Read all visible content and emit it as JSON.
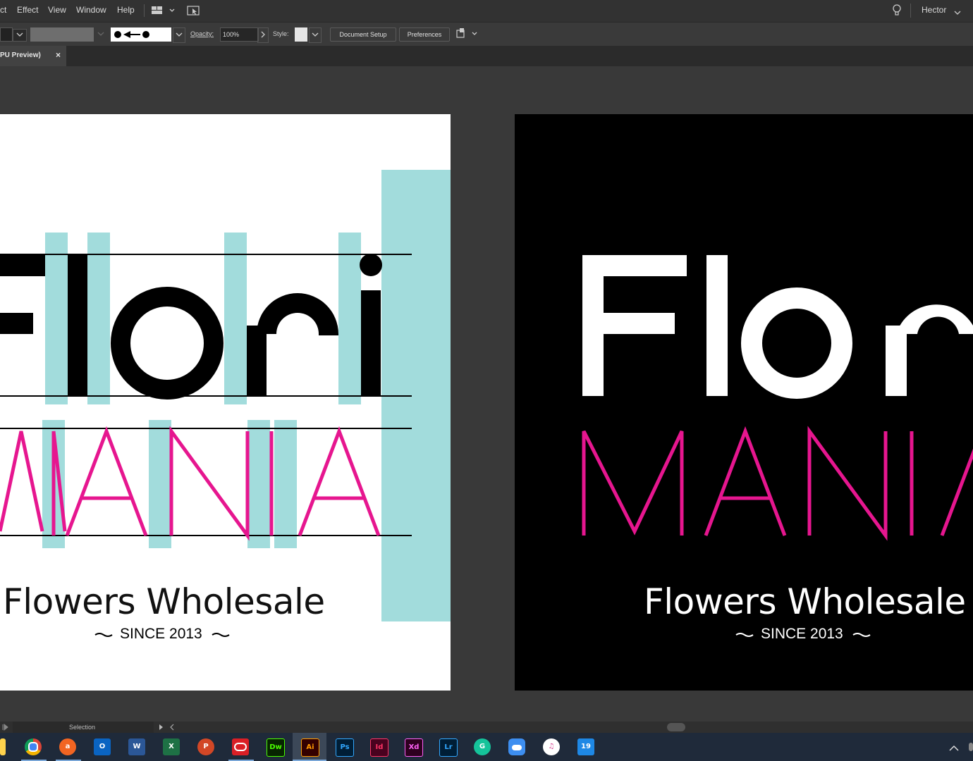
{
  "menubar": {
    "items": [
      "ct",
      "Effect",
      "View",
      "Window",
      "Help"
    ],
    "user": "Hector"
  },
  "options": {
    "opacity_label": "Opacity:",
    "opacity_value": "100%",
    "style_label": "Style:",
    "document_setup": "Document Setup",
    "preferences": "Preferences"
  },
  "tab": {
    "title": "PU Preview)",
    "close": "×"
  },
  "artwork": {
    "logo_top": "Flori",
    "logo_bottom": "MANIA",
    "tagline": "Flowers Wholesale",
    "since": "SINCE 2013"
  },
  "colors": {
    "pink": "#e6168f",
    "guide_teal": "#a2dcdc",
    "art_white": "#ffffff",
    "art_black": "#000000"
  },
  "status": {
    "tool": "Selection"
  },
  "taskbar": {
    "apps": [
      {
        "icon": "chrome-icon",
        "label": ""
      },
      {
        "icon": "avast-icon",
        "label": "a"
      },
      {
        "icon": "outlook-icon",
        "label": "O"
      },
      {
        "icon": "word-icon",
        "label": "W"
      },
      {
        "icon": "excel-icon",
        "label": "X"
      },
      {
        "icon": "powerpoint-icon",
        "label": "P"
      },
      {
        "icon": "creative-cloud-icon",
        "label": ""
      },
      {
        "icon": "dreamweaver-icon",
        "label": "Dw"
      },
      {
        "icon": "illustrator-icon",
        "label": "Ai"
      },
      {
        "icon": "photoshop-icon",
        "label": "Ps"
      },
      {
        "icon": "indesign-icon",
        "label": "Id"
      },
      {
        "icon": "xd-icon",
        "label": "Xd"
      },
      {
        "icon": "lightroom-icon",
        "label": "Lr"
      },
      {
        "icon": "grammarly-icon",
        "label": "G"
      },
      {
        "icon": "icloud-icon",
        "label": ""
      },
      {
        "icon": "itunes-icon",
        "label": "♫"
      },
      {
        "icon": "calendar-icon",
        "label": "19"
      }
    ]
  }
}
